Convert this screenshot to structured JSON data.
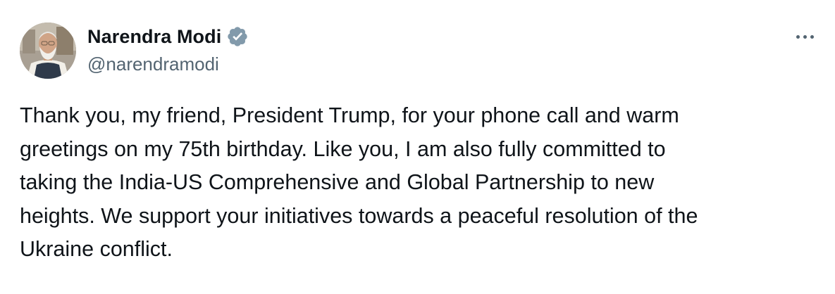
{
  "author": {
    "display_name": "Narendra Modi",
    "handle": "@narendramodi",
    "verified": true,
    "verified_color": "#829aab"
  },
  "tweet": {
    "text": "Thank you, my friend, President Trump, for your phone call and warm\ngreetings on my 75th birthday. Like you, I am also fully committed to\ntaking the India-US Comprehensive and Global Partnership to new\nheights. We support your initiatives towards a peaceful resolution of the\nUkraine conflict."
  },
  "icons": {
    "avatar": "profile-photo",
    "verified": "verified-badge-icon",
    "more": "more-options-icon"
  },
  "colors": {
    "text": "#0f1419",
    "secondary": "#536471",
    "background": "#ffffff"
  }
}
